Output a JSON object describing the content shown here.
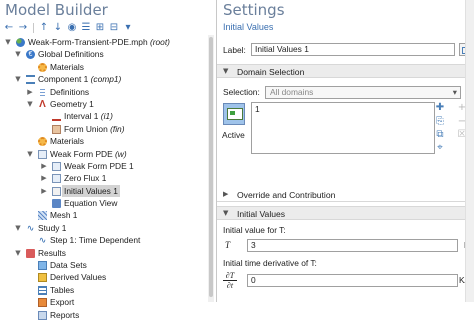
{
  "model_builder": {
    "title": "Model Builder",
    "toolbar": [
      {
        "name": "back-icon",
        "glyph": "←"
      },
      {
        "name": "forward-icon",
        "glyph": "→"
      },
      {
        "name": "move-up-icon",
        "glyph": "↑"
      },
      {
        "name": "move-down-icon",
        "glyph": "↓"
      },
      {
        "name": "show-icon",
        "glyph": "◉"
      },
      {
        "name": "sort-icon",
        "glyph": "☰"
      },
      {
        "name": "expand-all-icon",
        "glyph": "⊞"
      },
      {
        "name": "collapse-all-icon",
        "glyph": "⊟"
      },
      {
        "name": "tree-menu-icon",
        "glyph": "▾"
      }
    ],
    "tree": {
      "root": {
        "label": "Weak-Form-Transient-PDE.mph",
        "tag": "(root)"
      },
      "global_definitions": "Global Definitions",
      "global_materials": "Materials",
      "component": {
        "label": "Component 1",
        "tag": "(comp1)"
      },
      "definitions": "Definitions",
      "geometry": "Geometry 1",
      "interval": {
        "label": "Interval 1",
        "tag": "(i1)"
      },
      "form_union": {
        "label": "Form Union",
        "tag": "(fin)"
      },
      "materials": "Materials",
      "weak_form_pde": {
        "label": "Weak Form PDE",
        "tag": "(w)"
      },
      "weak_form_pde_1": "Weak Form PDE 1",
      "zero_flux": "Zero Flux 1",
      "initial_values": "Initial Values 1",
      "equation_view": "Equation View",
      "mesh": "Mesh 1",
      "study": "Study 1",
      "study_step": "Step 1: Time Dependent",
      "results": "Results",
      "data_sets": "Data Sets",
      "derived_values": "Derived Values",
      "tables": "Tables",
      "export": "Export",
      "reports": "Reports"
    }
  },
  "settings": {
    "title": "Settings",
    "subtitle": "Initial Values",
    "label_caption": "Label:",
    "label_value": "Initial Values 1",
    "domain_selection": {
      "header": "Domain Selection",
      "selection_caption": "Selection:",
      "selection_value": "All domains",
      "active_label": "Active",
      "items": [
        "1"
      ]
    },
    "override_header": "Override and Contribution",
    "initial_values": {
      "header": "Initial Values",
      "caption_1": "Initial value for T:",
      "symbol_1": "T",
      "value_1": "3",
      "unit_1": "K",
      "caption_2": "Initial time derivative of T:",
      "symbol_2_num": "∂T",
      "symbol_2_den": "∂t",
      "value_2": "0",
      "unit_2": "K/s"
    },
    "side_tools": [
      {
        "name": "add-to-selection-icon",
        "glyph": "✚"
      },
      {
        "name": "copy-selection-icon",
        "glyph": "⎘"
      },
      {
        "name": "paste-selection-icon",
        "glyph": "⧉"
      },
      {
        "name": "zoom-to-selection-icon",
        "glyph": "⌖"
      },
      {
        "name": "add-icon",
        "glyph": "+"
      },
      {
        "name": "remove-icon",
        "glyph": "−"
      },
      {
        "name": "clear-selection-icon",
        "glyph": "☒"
      }
    ]
  }
}
